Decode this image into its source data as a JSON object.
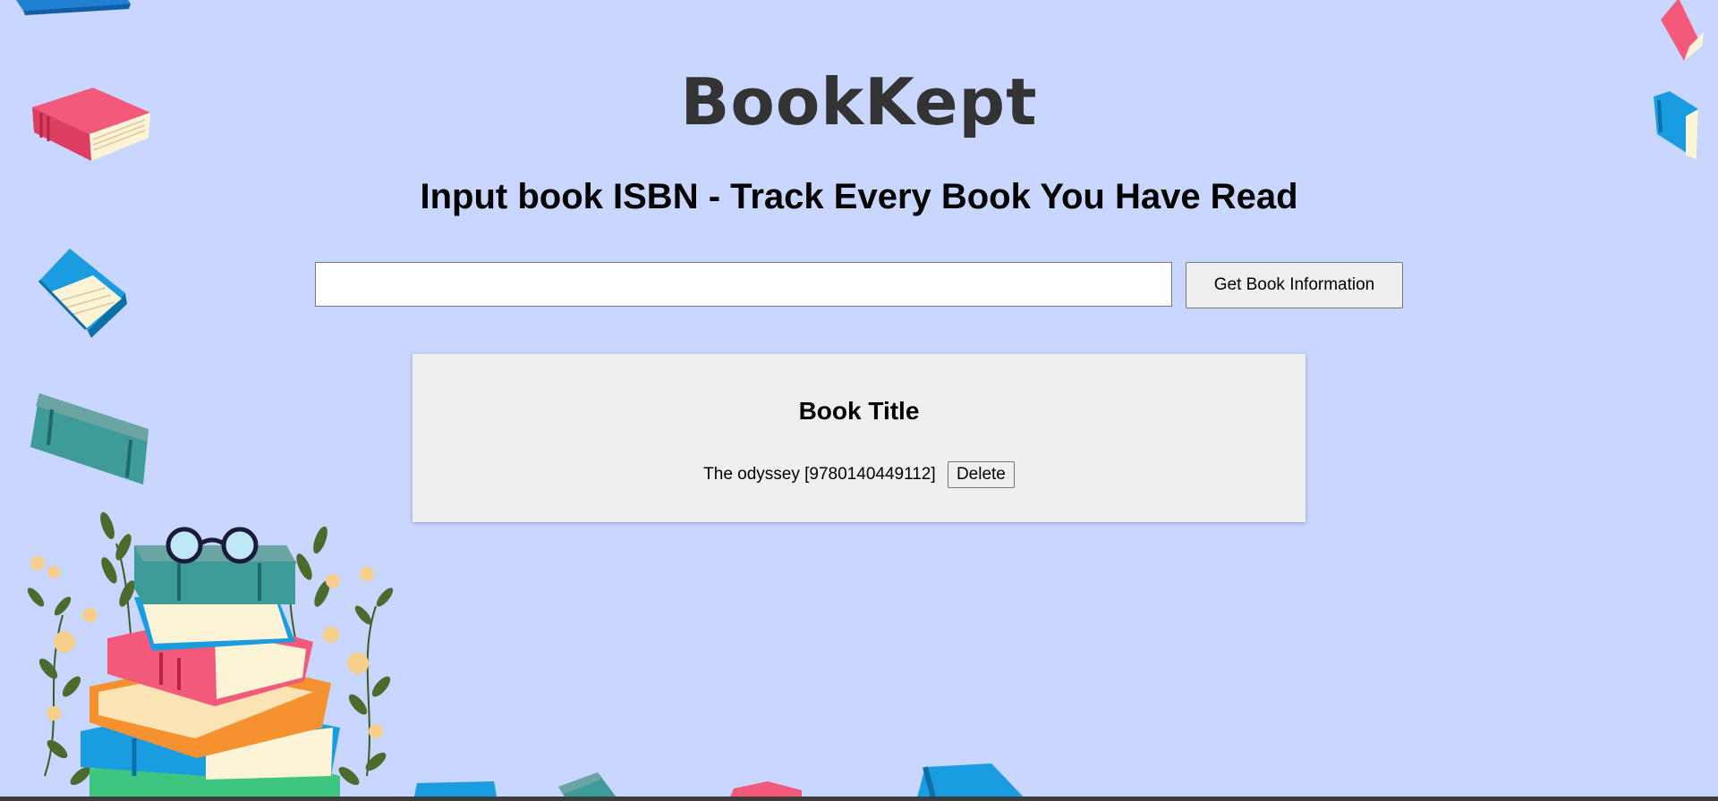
{
  "app": {
    "logo": "BookKept",
    "tagline": "Input book ISBN - Track Every Book You Have Read"
  },
  "search": {
    "value": "",
    "placeholder": "",
    "button_label": "Get Book Information"
  },
  "books": {
    "heading": "Book Title",
    "items": [
      {
        "title": "The odyssey",
        "isbn": "9780140449112",
        "display": "The odyssey [9780140449112]",
        "delete_label": "Delete"
      }
    ]
  },
  "colors": {
    "background": "#c9d6fd",
    "card": "#efefef",
    "logo_text": "#333333",
    "book_pink": "#f2597a",
    "book_blue": "#1a9de0",
    "book_teal": "#3d9b98",
    "book_orange": "#f5922f",
    "book_green": "#3ec680",
    "leaf_green": "#4a6b2c",
    "flower": "#f6cf8b"
  },
  "icons": {
    "decoration": [
      "book-icon",
      "book-stack-icon",
      "glasses-icon",
      "flower-icon"
    ]
  }
}
